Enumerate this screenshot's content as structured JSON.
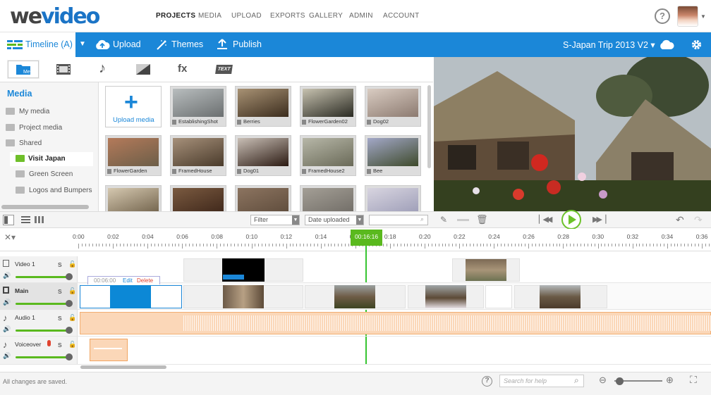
{
  "brand": {
    "logo_we": "we",
    "logo_video": "video"
  },
  "top_nav": [
    "PROJECTS",
    "MEDIA",
    "UPLOAD",
    "EXPORTS",
    "GALLERY",
    "ADMIN",
    "ACCOUNT"
  ],
  "top_nav_active": "PROJECTS",
  "toolbar": {
    "timeline_label": "Timeline (A)",
    "upload_label": "Upload",
    "themes_label": "Themes",
    "publish_label": "Publish",
    "project_title": "S-Japan Trip 2013 V2 ▾"
  },
  "media_tab_icons": [
    "media-icon",
    "film-icon",
    "music-note-icon",
    "transition-icon",
    "fx-icon",
    "text-icon"
  ],
  "media_tab_texts": {
    "fx": "fx",
    "text": "TEXT"
  },
  "sidebar": {
    "heading": "Media",
    "folders": [
      {
        "label": "My media"
      },
      {
        "label": "Project media"
      },
      {
        "label": "Shared"
      },
      {
        "label": "Visit Japan"
      },
      {
        "label": "Green Screen"
      },
      {
        "label": "Logos and Bumpers"
      }
    ]
  },
  "upload_tile_label": "Upload media",
  "thumbnails": [
    {
      "caption": "EstablishingShot",
      "c1": "#6b6f70",
      "c2": "#b8bdbe"
    },
    {
      "caption": "Berries",
      "c1": "#3b2c1d",
      "c2": "#a89274"
    },
    {
      "caption": "FlowerGarden02",
      "c1": "#2a2a22",
      "c2": "#c7c2b0"
    },
    {
      "caption": "Dog02",
      "c1": "#8c7a70",
      "c2": "#d9ccc2"
    },
    {
      "caption": "FlowerGarden",
      "c1": "#6c5e48",
      "c2": "#b47a5a"
    },
    {
      "caption": "FramedHouse",
      "c1": "#4a3b2b",
      "c2": "#a6907a"
    },
    {
      "caption": "Dog01",
      "c1": "#2b1a12",
      "c2": "#c9bfb6"
    },
    {
      "caption": "FramedHouse2",
      "c1": "#6a6a58",
      "c2": "#b7b7a8"
    },
    {
      "caption": "Bee",
      "c1": "#3e4a2b",
      "c2": "#a3a8c8"
    },
    {
      "caption": "",
      "c1": "#6b5c45",
      "c2": "#d5c8b0"
    },
    {
      "caption": "",
      "c1": "#3b2418",
      "c2": "#7a5a40"
    },
    {
      "caption": "",
      "c1": "#5c4a3a",
      "c2": "#8c7460"
    },
    {
      "caption": "",
      "c1": "#6e6a64",
      "c2": "#a49f96"
    },
    {
      "caption": "",
      "c1": "#9a9ab5",
      "c2": "#d8d5e0"
    }
  ],
  "controls": {
    "filter_label": "Filter",
    "sort_label": "Date uploaded"
  },
  "ruler": {
    "ticks": [
      "0:00",
      "0:02",
      "0:04",
      "0:06",
      "0:08",
      "0:10",
      "0:12",
      "0:14",
      "0:16",
      "0:18",
      "0:20",
      "0:22",
      "0:24",
      "0:26",
      "0:28",
      "0:30",
      "0:32",
      "0:34",
      "0:36"
    ],
    "playhead_time": "00:16:16"
  },
  "tracks": [
    {
      "name": "Video 1",
      "volume": 1.0
    },
    {
      "name": "Main",
      "volume": 1.0
    },
    {
      "name": "Audio 1",
      "volume": 1.0
    },
    {
      "name": "Voiceover",
      "volume": 1.0
    }
  ],
  "track_solo_label": "S",
  "clip_popup": {
    "time": "00:06:00",
    "edit": "Edit",
    "delete": "Delete"
  },
  "status": {
    "saved_text": "All changes are saved.",
    "help_placeholder": "Search for help"
  },
  "colors": {
    "brand_blue": "#1b87d8",
    "accent_green": "#5ab91e",
    "audio_orange": "#fbd7b8"
  }
}
